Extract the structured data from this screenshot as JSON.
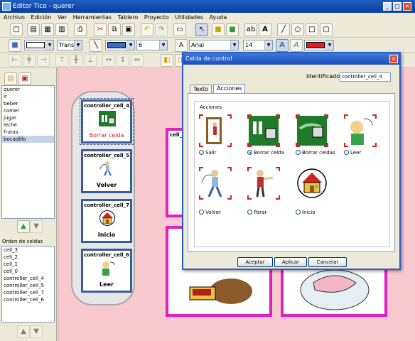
{
  "window": {
    "title": "Editor Tico - querer"
  },
  "menu": [
    "Archivo",
    "Edición",
    "Ver",
    "Herramientas",
    "Tablero",
    "Proyecto",
    "Utilidades",
    "Ayuda"
  ],
  "toolbar": {
    "transparency_value": "Trans",
    "line_width_value": "6",
    "font_value": "Arial",
    "font_size_value": "14",
    "colors": {
      "fill": "#ffffff",
      "line": "#3b6bbf",
      "text": "#e02020"
    }
  },
  "left_panel": {
    "boards": [
      "querer",
      "ir",
      "beber",
      "comer",
      "jugar",
      "leche",
      "frutas",
      "bocadillo"
    ],
    "selected_board": "bocadillo",
    "order_label": "Orden de celdas",
    "order": [
      "cell_3",
      "cell_2",
      "cell_1",
      "cell_0",
      "controller_cell_4",
      "controller_cell_5",
      "controller_cell_7",
      "controller_cell_6"
    ]
  },
  "canvas": {
    "cells": [
      {
        "name": "controller_cell_4",
        "caption": "Borrar celda"
      },
      {
        "name": "controller_cell_5",
        "caption": "Volver"
      },
      {
        "name": "controller_cell_7",
        "caption": "Inicio"
      },
      {
        "name": "controller_cell_6",
        "caption": "Leer"
      }
    ],
    "board_label": "cell_"
  },
  "dialog": {
    "title": "Celda de control",
    "identifier_label": "Identificador",
    "identifier_value": "controller_cell_4",
    "tabs": [
      "Texto",
      "Acciones"
    ],
    "active_tab": "Acciones",
    "group_title": "Acciones",
    "actions": [
      {
        "label": "Salir",
        "icon": "exit-door-icon",
        "selected": false
      },
      {
        "label": "Borrar celda",
        "icon": "erase-cell-icon",
        "selected": true
      },
      {
        "label": "Borrar celdas",
        "icon": "erase-cells-icon",
        "selected": false
      },
      {
        "label": "Leer",
        "icon": "read-icon",
        "selected": false
      },
      {
        "label": "Volver",
        "icon": "go-back-icon",
        "selected": false
      },
      {
        "label": "Parar",
        "icon": "stop-icon",
        "selected": false
      },
      {
        "label": "Inicio",
        "icon": "home-icon",
        "selected": false
      }
    ],
    "buttons": {
      "accept": "Aceptar",
      "apply": "Aplicar",
      "cancel": "Cancelar"
    }
  }
}
